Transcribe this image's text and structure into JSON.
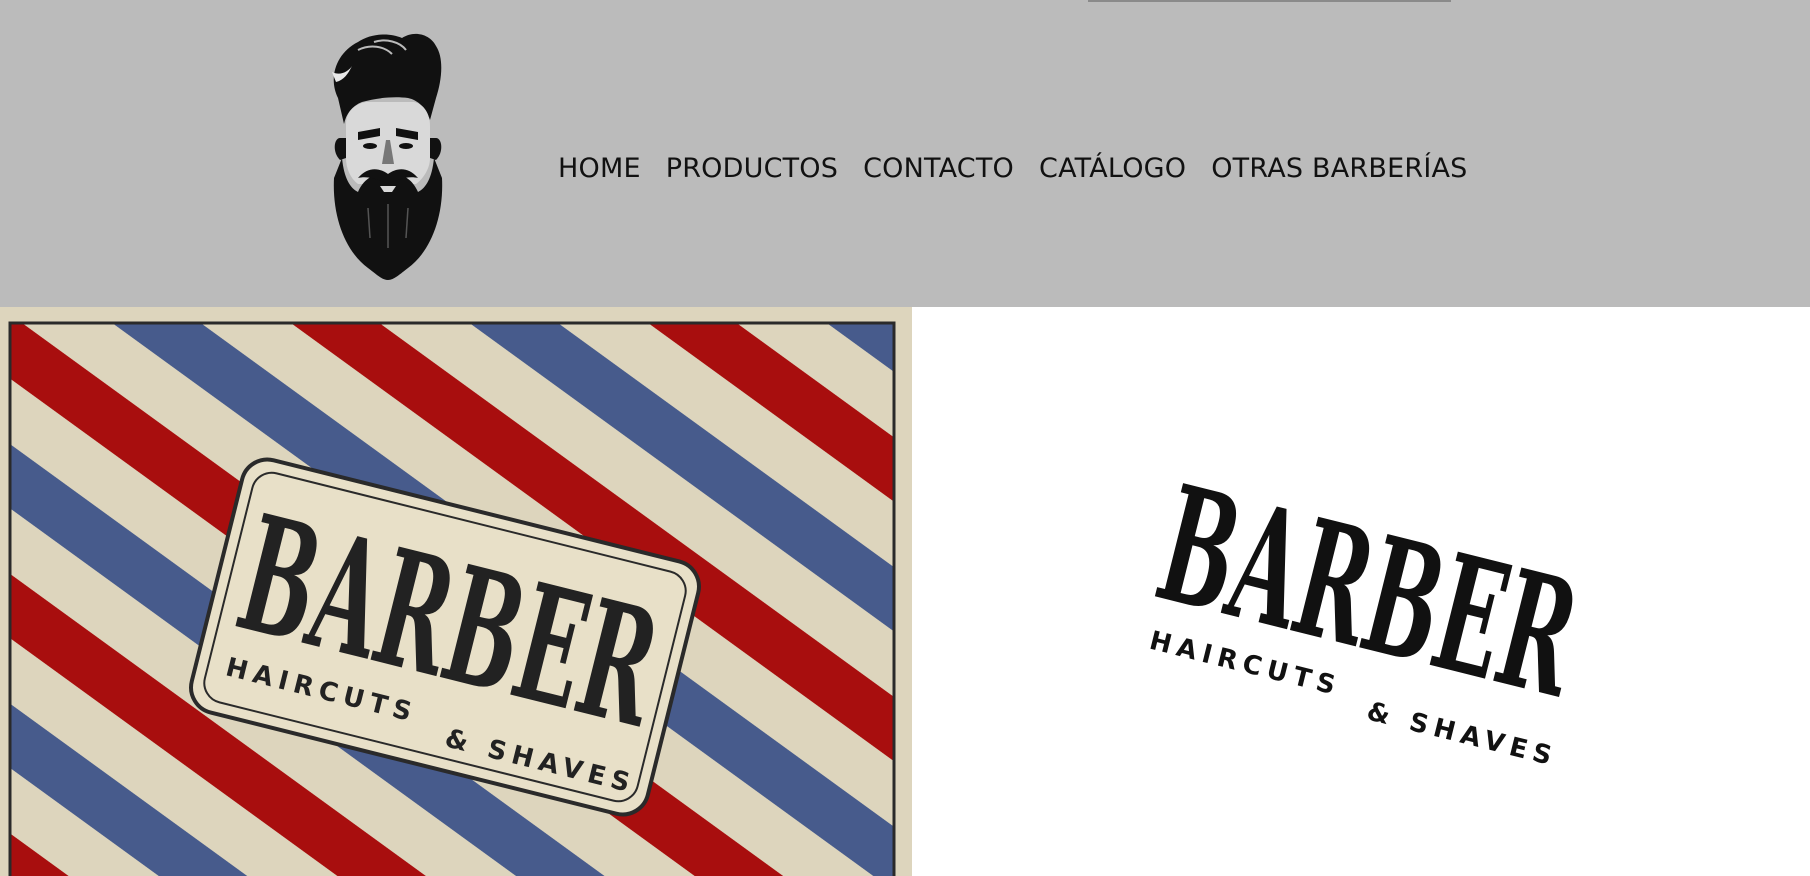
{
  "header": {
    "logo_icon": "bearded-man-icon",
    "background_color": "#bbbbbb"
  },
  "nav": {
    "items": [
      {
        "label": "HOME"
      },
      {
        "label": "PRODUCTOS"
      },
      {
        "label": "CONTACTO"
      },
      {
        "label": "CATÁLOGO"
      },
      {
        "label": "OTRAS BARBERÍAS"
      }
    ]
  },
  "hero": {
    "left_image": {
      "title": "BARBER",
      "subtitle_left": "HAIRCUTS",
      "subtitle_right": "& SHAVES",
      "colors": {
        "cream": "#ddd5bd",
        "red": "#a80e0e",
        "blue": "#475b8c",
        "ink": "#222222"
      }
    },
    "right_image": {
      "title": "BARBER",
      "subtitle_left": "HAIRCUTS",
      "subtitle_right": "& SHAVES"
    }
  }
}
